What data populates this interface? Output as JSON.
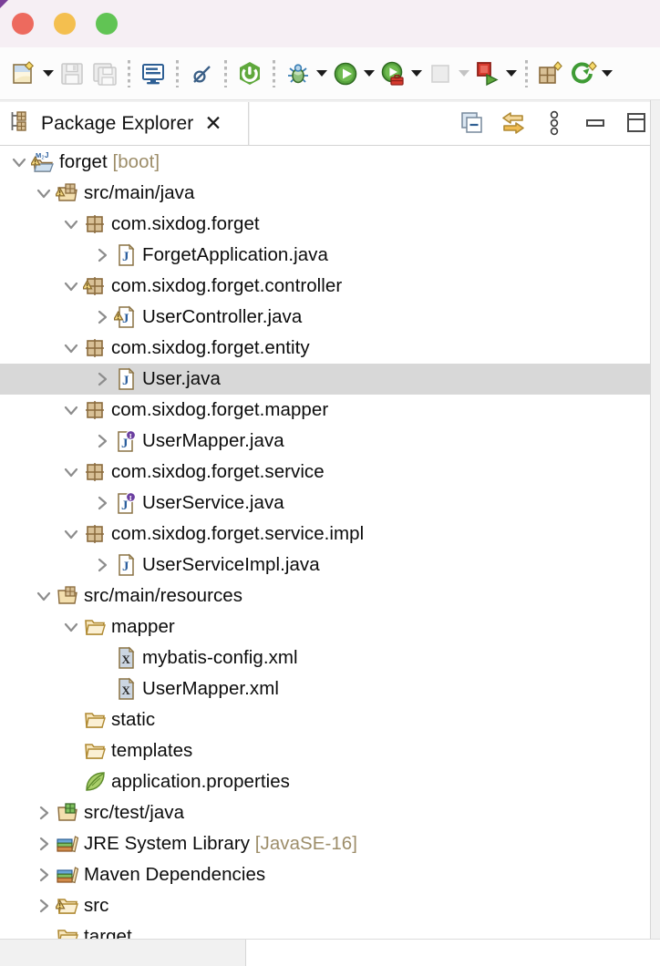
{
  "window": {
    "traffic_lights": [
      {
        "name": "close",
        "color": "#ed6a5e"
      },
      {
        "name": "minimize",
        "color": "#f4bf4f"
      },
      {
        "name": "zoom",
        "color": "#61c454"
      }
    ]
  },
  "toolbar": {
    "items": [
      {
        "name": "new-wizard",
        "icon": "new-file-icon",
        "dropdown": true,
        "enabled": true
      },
      {
        "name": "save",
        "icon": "save-icon",
        "dropdown": false,
        "enabled": false
      },
      {
        "name": "save-all",
        "icon": "save-all-icon",
        "dropdown": false,
        "enabled": false
      },
      {
        "name": "separator",
        "icon": "separator",
        "dropdown": false,
        "enabled": true
      },
      {
        "name": "open-console",
        "icon": "console-icon",
        "dropdown": false,
        "enabled": true
      },
      {
        "name": "separator",
        "icon": "separator",
        "dropdown": false,
        "enabled": true
      },
      {
        "name": "skip-all-breakpoints",
        "icon": "skip-breakpoints-icon",
        "dropdown": false,
        "enabled": true
      },
      {
        "name": "separator",
        "icon": "separator",
        "dropdown": false,
        "enabled": true
      },
      {
        "name": "spring-boot-dashboard",
        "icon": "spring-boot-icon",
        "dropdown": false,
        "enabled": true
      },
      {
        "name": "separator",
        "icon": "separator",
        "dropdown": false,
        "enabled": true
      },
      {
        "name": "debug",
        "icon": "debug-bug-icon",
        "dropdown": true,
        "enabled": true
      },
      {
        "name": "run",
        "icon": "run-play-icon",
        "dropdown": true,
        "enabled": true
      },
      {
        "name": "run-external-tools",
        "icon": "run-toolbox-icon",
        "dropdown": true,
        "enabled": true
      },
      {
        "name": "coverage",
        "icon": "coverage-icon",
        "dropdown": true,
        "enabled": false
      },
      {
        "name": "stop-and-run",
        "icon": "stop-run-icon",
        "dropdown": true,
        "enabled": true
      },
      {
        "name": "separator",
        "icon": "separator",
        "dropdown": false,
        "enabled": true
      },
      {
        "name": "new-java-package",
        "icon": "new-package-icon",
        "dropdown": false,
        "enabled": true
      },
      {
        "name": "new-spring-element",
        "icon": "new-spring-icon",
        "dropdown": true,
        "enabled": true
      }
    ]
  },
  "view": {
    "tab_label": "Package Explorer",
    "close_glyph": "✕",
    "tools": [
      {
        "name": "collapse-all-button",
        "icon": "collapse-all-icon"
      },
      {
        "name": "link-with-editor-button",
        "icon": "link-editor-icon"
      },
      {
        "name": "view-menu-button",
        "icon": "vertical-dots-icon"
      },
      {
        "name": "minimize-view-button",
        "icon": "minimize-icon"
      },
      {
        "name": "maximize-view-button",
        "icon": "maximize-icon"
      }
    ]
  },
  "colors": {
    "selection_bg": "#d8d8d8",
    "decoration_text": "#9d8d69",
    "label_text": "#0c0c0c",
    "toolbar_bg": "#fcfcfc",
    "titlebar_bg": "#f6eff4"
  },
  "tree": {
    "nodes": [
      {
        "label": "forget ",
        "suffix": "[boot]",
        "indent": 0,
        "twisty": "expanded",
        "icon": "maven-java-project-warning-icon",
        "selected": false
      },
      {
        "label": "src/main/java",
        "suffix": "",
        "indent": 1,
        "twisty": "expanded",
        "icon": "source-folder-warning-icon",
        "selected": false
      },
      {
        "label": "com.sixdog.forget",
        "suffix": "",
        "indent": 2,
        "twisty": "expanded",
        "icon": "package-icon",
        "selected": false
      },
      {
        "label": "ForgetApplication.java",
        "suffix": "",
        "indent": 3,
        "twisty": "collapsed",
        "icon": "java-class-icon",
        "selected": false
      },
      {
        "label": "com.sixdog.forget.controller",
        "suffix": "",
        "indent": 2,
        "twisty": "expanded",
        "icon": "package-warning-icon",
        "selected": false
      },
      {
        "label": "UserController.java",
        "suffix": "",
        "indent": 3,
        "twisty": "collapsed",
        "icon": "java-class-warning-icon",
        "selected": false
      },
      {
        "label": "com.sixdog.forget.entity",
        "suffix": "",
        "indent": 2,
        "twisty": "expanded",
        "icon": "package-icon",
        "selected": false
      },
      {
        "label": "User.java",
        "suffix": "",
        "indent": 3,
        "twisty": "collapsed",
        "icon": "java-class-icon",
        "selected": true
      },
      {
        "label": "com.sixdog.forget.mapper",
        "suffix": "",
        "indent": 2,
        "twisty": "expanded",
        "icon": "package-icon",
        "selected": false
      },
      {
        "label": "UserMapper.java",
        "suffix": "",
        "indent": 3,
        "twisty": "collapsed",
        "icon": "java-interface-icon",
        "selected": false
      },
      {
        "label": "com.sixdog.forget.service",
        "suffix": "",
        "indent": 2,
        "twisty": "expanded",
        "icon": "package-icon",
        "selected": false
      },
      {
        "label": "UserService.java",
        "suffix": "",
        "indent": 3,
        "twisty": "collapsed",
        "icon": "java-interface-icon",
        "selected": false
      },
      {
        "label": "com.sixdog.forget.service.impl",
        "suffix": "",
        "indent": 2,
        "twisty": "expanded",
        "icon": "package-icon",
        "selected": false
      },
      {
        "label": "UserServiceImpl.java",
        "suffix": "",
        "indent": 3,
        "twisty": "collapsed",
        "icon": "java-class-icon",
        "selected": false
      },
      {
        "label": "src/main/resources",
        "suffix": "",
        "indent": 1,
        "twisty": "expanded",
        "icon": "source-folder-icon",
        "selected": false
      },
      {
        "label": "mapper",
        "suffix": "",
        "indent": 2,
        "twisty": "expanded",
        "icon": "folder-icon",
        "selected": false
      },
      {
        "label": "mybatis-config.xml",
        "suffix": "",
        "indent": 3,
        "twisty": "none",
        "icon": "xml-file-icon",
        "selected": false
      },
      {
        "label": "UserMapper.xml",
        "suffix": "",
        "indent": 3,
        "twisty": "none",
        "icon": "xml-file-icon",
        "selected": false
      },
      {
        "label": "static",
        "suffix": "",
        "indent": 2,
        "twisty": "none",
        "icon": "folder-icon",
        "selected": false
      },
      {
        "label": "templates",
        "suffix": "",
        "indent": 2,
        "twisty": "none",
        "icon": "folder-icon",
        "selected": false
      },
      {
        "label": "application.properties",
        "suffix": "",
        "indent": 2,
        "twisty": "none",
        "icon": "spring-leaf-icon",
        "selected": false
      },
      {
        "label": "src/test/java",
        "suffix": "",
        "indent": 1,
        "twisty": "collapsed",
        "icon": "test-source-folder-icon",
        "selected": false
      },
      {
        "label": "JRE System Library ",
        "suffix": "[JavaSE-16]",
        "indent": 1,
        "twisty": "collapsed",
        "icon": "library-icon",
        "selected": false
      },
      {
        "label": "Maven Dependencies",
        "suffix": "",
        "indent": 1,
        "twisty": "collapsed",
        "icon": "library-icon",
        "selected": false
      },
      {
        "label": "src",
        "suffix": "",
        "indent": 1,
        "twisty": "collapsed",
        "icon": "folder-warning-icon",
        "selected": false
      },
      {
        "label": "target",
        "suffix": "",
        "indent": 1,
        "twisty": "none",
        "icon": "folder-icon",
        "selected": false
      }
    ]
  }
}
